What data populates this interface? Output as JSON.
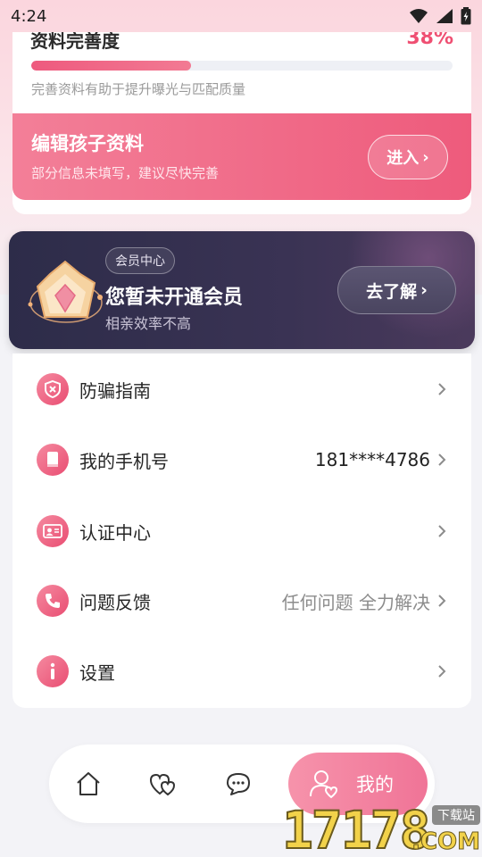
{
  "status_bar": {
    "time": "4:24"
  },
  "profile": {
    "completeness_title": "资料完善度",
    "completeness_percent": "38%",
    "progress_fraction": 0.38,
    "hint": "完善资料有助于提升曝光与匹配质量",
    "edit": {
      "title": "编辑孩子资料",
      "subtitle": "部分信息未填写，建议尽快完善",
      "button": "进入",
      "arrow": "›"
    }
  },
  "vip": {
    "tag": "会员中心",
    "title": "您暂未开通会员",
    "subtitle": "相亲效率不高",
    "button": "去了解",
    "arrow": "›"
  },
  "menu": [
    {
      "icon": "shield-icon",
      "label": "防骗指南",
      "value": ""
    },
    {
      "icon": "phone-book-icon",
      "label": "我的手机号",
      "value": "181****4786"
    },
    {
      "icon": "id-card-icon",
      "label": "认证中心",
      "value": ""
    },
    {
      "icon": "phone-icon",
      "label": "问题反馈",
      "value": "任何问题 全力解决"
    },
    {
      "icon": "info-icon",
      "label": "设置",
      "value": ""
    }
  ],
  "tab_bar": {
    "tabs": [
      {
        "icon": "home-icon"
      },
      {
        "icon": "hearts-icon"
      },
      {
        "icon": "chat-icon"
      }
    ],
    "active": {
      "icon": "user-heart-icon",
      "label": "我的"
    }
  },
  "watermark": {
    "number": "17178",
    "tag": "下载站",
    "domain": ".COM"
  },
  "colors": {
    "accent": "#ee5b7c",
    "vip_bg": "#2d2c49",
    "page_bg": "#f3f3f7"
  }
}
